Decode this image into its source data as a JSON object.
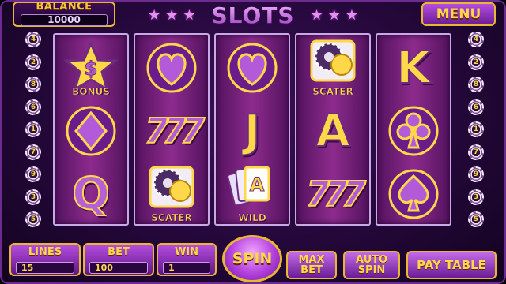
{
  "header": {
    "balance_label": "BALANCE",
    "balance_value": "10000",
    "title": "SLOTS",
    "menu_label": "MENU"
  },
  "paylines": {
    "left": [
      "4",
      "2",
      "8",
      "6",
      "1",
      "7",
      "9",
      "3",
      "5"
    ],
    "right": [
      "4",
      "2",
      "8",
      "6",
      "1",
      "7",
      "9",
      "3",
      "5"
    ]
  },
  "reels": [
    {
      "symbols": [
        {
          "kind": "dollar-star",
          "caption": "BONUS"
        },
        {
          "kind": "diamond",
          "caption": ""
        },
        {
          "kind": "letter",
          "text": "Q",
          "caption": ""
        }
      ]
    },
    {
      "symbols": [
        {
          "kind": "heart",
          "caption": ""
        },
        {
          "kind": "sevens",
          "text": "777",
          "caption": ""
        },
        {
          "kind": "chips",
          "caption": "SCATER"
        }
      ]
    },
    {
      "symbols": [
        {
          "kind": "heart",
          "caption": ""
        },
        {
          "kind": "letter",
          "text": "J",
          "caption": ""
        },
        {
          "kind": "cards",
          "text": "A",
          "caption": "WILD"
        }
      ]
    },
    {
      "symbols": [
        {
          "kind": "chips",
          "caption": "SCATER"
        },
        {
          "kind": "letter",
          "text": "A",
          "caption": ""
        },
        {
          "kind": "sevens",
          "text": "777",
          "caption": ""
        }
      ]
    },
    {
      "symbols": [
        {
          "kind": "letter",
          "text": "K",
          "caption": ""
        },
        {
          "kind": "club",
          "caption": ""
        },
        {
          "kind": "spade",
          "caption": ""
        }
      ]
    }
  ],
  "controls": {
    "lines": {
      "label": "LINES",
      "value": "15"
    },
    "bet": {
      "label": "BET",
      "value": "100"
    },
    "win": {
      "label": "WIN",
      "value": "1"
    },
    "spin_label": "SPIN",
    "max_bet_label": "MAX\nBET",
    "auto_spin_label": "AUTO\nSPIN",
    "pay_table_label": "PAY TABLE"
  },
  "colors": {
    "gold": "#ffd84a",
    "purple": "#b35ad8",
    "background": "#24083a"
  }
}
